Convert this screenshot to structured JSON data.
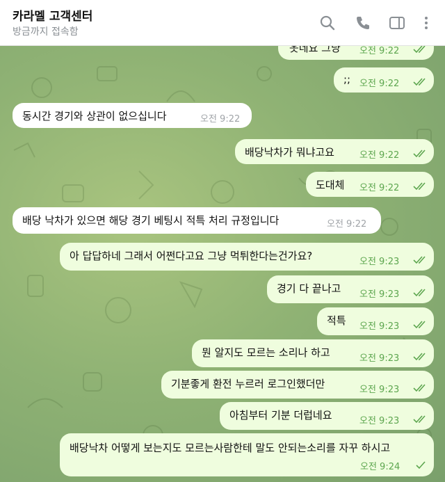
{
  "header": {
    "title": "카라멜 고객센터",
    "status": "방금까지 접속함",
    "icons": [
      "search-icon",
      "phone-icon",
      "sidebar-icon",
      "more-icon"
    ]
  },
  "messages": [
    {
      "text": "옷네요 그냥",
      "time": "오전 9:22",
      "direction": "out",
      "status": "read"
    },
    {
      "text": ";;",
      "time": "오전 9:22",
      "direction": "out",
      "status": "read"
    },
    {
      "text": "동시간 경기와 상관이 없으십니다",
      "time": "오전 9:22",
      "direction": "in"
    },
    {
      "text": "배당낙차가 뭐냐고요",
      "time": "오전 9:22",
      "direction": "out",
      "status": "read"
    },
    {
      "text": "도대체",
      "time": "오전 9:22",
      "direction": "out",
      "status": "read"
    },
    {
      "text": "배당 낙차가 있으면 해당 경기 베팅시 적특 처리 규정입니다",
      "time": "오전 9:22",
      "direction": "in"
    },
    {
      "text": "아 답답하네 그래서 어쩐다고요 그냥 먹튀한다는건가요?",
      "time": "오전 9:23",
      "direction": "out",
      "status": "read"
    },
    {
      "text": "경기 다 끝나고",
      "time": "오전 9:23",
      "direction": "out",
      "status": "read"
    },
    {
      "text": "적특",
      "time": "오전 9:23",
      "direction": "out",
      "status": "read"
    },
    {
      "text": "뭔 알지도 모르는 소리나 하고",
      "time": "오전 9:23",
      "direction": "out",
      "status": "read"
    },
    {
      "text": "기분좋게 환전 누르러 로그인했더만",
      "time": "오전 9:23",
      "direction": "out",
      "status": "read"
    },
    {
      "text": "아침부터 기분 더럽네요",
      "time": "오전 9:23",
      "direction": "out",
      "status": "read"
    },
    {
      "text": "배당낙차 어떻게 보는지도 모르는사람한테 말도 안되는소리를 자꾸 하시고",
      "time": "오전 9:24",
      "direction": "out",
      "status": "sent"
    }
  ]
}
